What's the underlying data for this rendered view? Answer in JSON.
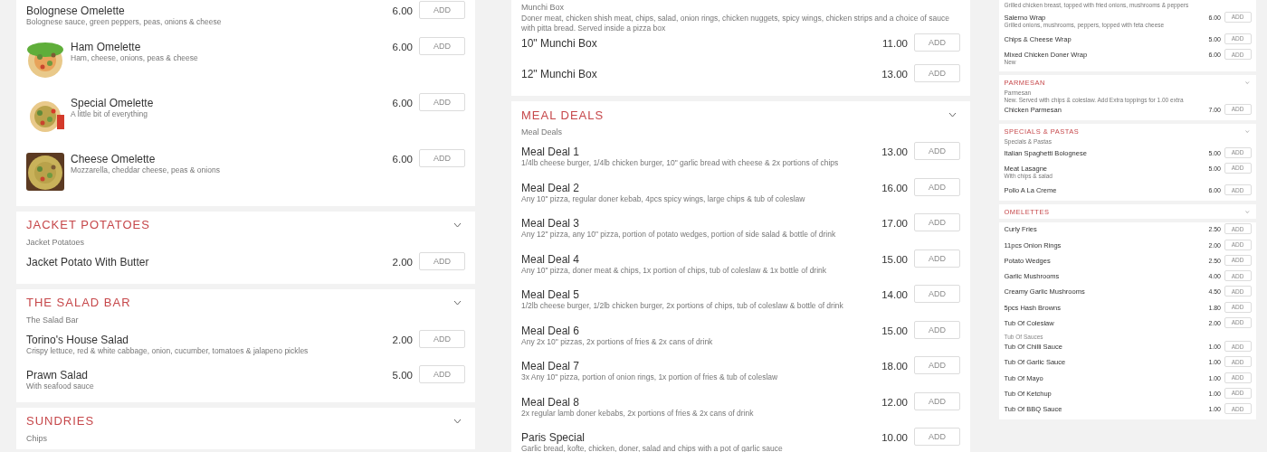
{
  "columns": [
    {
      "sections": [
        {
          "items": [
            {
              "kind": "item",
              "name": "Bolognese Omelette",
              "description": "Bolognese sauce, green peppers, peas, onions & cheese",
              "price": "6.00",
              "button": "ADD"
            },
            {
              "kind": "item",
              "name": "Ham Omelette",
              "description": "Ham, cheese, onions, peas & cheese",
              "price": "6.00",
              "button": "ADD"
            },
            {
              "kind": "item",
              "name": "Special Omelette",
              "description": "A little bit of everything",
              "price": "6.00",
              "button": "ADD"
            },
            {
              "kind": "item",
              "name": "Cheese Omelette",
              "description": "Mozzarella, cheddar cheese, peas & onions",
              "price": "6.00",
              "button": "ADD"
            }
          ]
        },
        {
          "title": "JACKET POTATOES",
          "subtitle": "Jacket Potatoes",
          "items": [
            {
              "kind": "item",
              "name": "Jacket Potato With Butter",
              "price": "2.00",
              "button": "ADD"
            }
          ]
        },
        {
          "title": "THE SALAD BAR",
          "subtitle": "The Salad Bar",
          "items": [
            {
              "kind": "item",
              "name": "Torino's House Salad",
              "description": "Crispy lettuce, red & white cabbage, onion, cucumber, tomatoes & jalapeno pickles",
              "price": "2.00",
              "button": "ADD"
            },
            {
              "kind": "item",
              "name": "Prawn Salad",
              "description": "With seafood sauce",
              "price": "5.00",
              "button": "ADD"
            }
          ]
        },
        {
          "title": "SUNDRIES",
          "subtitle": "Chips"
        }
      ]
    },
    {
      "sections": [
        {
          "subtitle": "Munchi Box",
          "description": "Doner meat, chicken shish meat, chips, salad, onion rings, chicken nuggets, spicy wings, chicken strips and a choice of sauce with pitta bread. Served inside a pizza box",
          "items": [
            {
              "kind": "item",
              "name": "10\" Munchi Box",
              "price": "11.00",
              "button": "ADD"
            },
            {
              "kind": "item",
              "name": "12\" Munchi Box",
              "price": "13.00",
              "button": "ADD"
            }
          ]
        },
        {
          "title": "MEAL DEALS",
          "subtitle": "Meal Deals",
          "items": [
            {
              "kind": "item",
              "name": "Meal Deal 1",
              "description": "1/4lb cheese burger, 1/4lb chicken burger, 10\" garlic bread with cheese & 2x portions of chips",
              "price": "13.00",
              "button": "ADD"
            },
            {
              "kind": "item",
              "name": "Meal Deal 2",
              "description": "Any 10\" pizza, regular doner kebab, 4pcs spicy wings, large chips & tub of coleslaw",
              "price": "16.00",
              "button": "ADD"
            },
            {
              "kind": "item",
              "name": "Meal Deal 3",
              "description": "Any 12\" pizza, any 10\" pizza, portion of potato wedges, portion of side salad & bottle of drink",
              "price": "17.00",
              "button": "ADD"
            },
            {
              "kind": "item",
              "name": "Meal Deal 4",
              "description": "Any 10\" pizza, doner meat & chips, 1x portion of chips, tub of coleslaw & 1x bottle of drink",
              "price": "15.00",
              "button": "ADD"
            },
            {
              "kind": "item",
              "name": "Meal Deal 5",
              "description": "1/2lb cheese burger, 1/2lb chicken burger, 2x portions of chips, tub of coleslaw & bottle of drink",
              "price": "14.00",
              "button": "ADD"
            },
            {
              "kind": "item",
              "name": "Meal Deal 6",
              "description": "Any 2x 10\" pizzas, 2x portions of fries & 2x cans of drink",
              "price": "15.00",
              "button": "ADD"
            },
            {
              "kind": "item",
              "name": "Meal Deal 7",
              "description": "3x Any 10\" pizza, portion of onion rings, 1x portion of fries & tub of coleslaw",
              "price": "18.00",
              "button": "ADD"
            },
            {
              "kind": "item",
              "name": "Meal Deal 8",
              "description": "2x regular lamb doner kebabs, 2x portions of fries & 2x cans of drink",
              "price": "12.00",
              "button": "ADD"
            },
            {
              "kind": "item",
              "name": "Paris Special",
              "description": "Garlic bread, kofte, chicken, doner, salad and chips with a pot of garlic sauce",
              "price": "10.00",
              "button": "ADD"
            }
          ]
        }
      ]
    },
    {
      "sections": [
        {
          "items": [
            {
              "kind": "note",
              "description": "Grilled chicken breast, topped with fried onions, mushrooms & peppers"
            },
            {
              "kind": "item",
              "name": "Salerno Wrap",
              "description": "Grilled onions, mushrooms, peppers, topped with feta cheese",
              "price": "6.00",
              "button": "ADD"
            },
            {
              "kind": "item",
              "name": "Chips & Cheese Wrap",
              "price": "5.00",
              "button": "ADD"
            },
            {
              "kind": "item",
              "name": "Mixed Chicken Doner Wrap",
              "description": "New",
              "price": "6.00",
              "button": "ADD"
            }
          ]
        },
        {
          "title": "PARMESAN",
          "subtitle": "Parmesan",
          "description": "New. Served with chips & coleslaw. Add Extra toppings for 1.00 extra",
          "items": [
            {
              "kind": "item",
              "name": "Chicken Parmesan",
              "price": "7.00",
              "button": "ADD"
            }
          ]
        },
        {
          "title": "SPECIALS & PASTAS",
          "subtitle": "Specials & Pastas",
          "items": [
            {
              "kind": "item",
              "name": "Italian Spaghetti Bolognese",
              "price": "5.00",
              "button": "ADD"
            },
            {
              "kind": "item",
              "name": "Meat Lasagne",
              "description": "With chips & salad",
              "price": "5.00",
              "button": "ADD"
            },
            {
              "kind": "item",
              "name": "Pollo A La Creme",
              "price": "6.00",
              "button": "ADD"
            }
          ]
        },
        {
          "title": "OMELETTES"
        },
        {
          "items": [
            {
              "kind": "item",
              "name": "Curly Fries",
              "price": "2.50",
              "button": "ADD"
            },
            {
              "kind": "item",
              "name": "11pcs Onion Rings",
              "price": "2.00",
              "button": "ADD"
            },
            {
              "kind": "item",
              "name": "Potato Wedges",
              "price": "2.50",
              "button": "ADD"
            },
            {
              "kind": "item",
              "name": "Garlic Mushrooms",
              "price": "4.00",
              "button": "ADD"
            },
            {
              "kind": "item",
              "name": "Creamy Garlic Mushrooms",
              "price": "4.50",
              "button": "ADD"
            },
            {
              "kind": "item",
              "name": "5pcs Hash Browns",
              "price": "1.80",
              "button": "ADD"
            },
            {
              "kind": "item",
              "name": "Tub Of Coleslaw",
              "price": "2.00",
              "button": "ADD"
            },
            {
              "kind": "subheading",
              "name": "Tub Of Sauces"
            },
            {
              "kind": "item",
              "name": "Tub Of Chilli Sauce",
              "price": "1.00",
              "button": "ADD"
            },
            {
              "kind": "item",
              "name": "Tub Of Garlic Sauce",
              "price": "1.00",
              "button": "ADD"
            },
            {
              "kind": "item",
              "name": "Tub Of Mayo",
              "price": "1.00",
              "button": "ADD"
            },
            {
              "kind": "item",
              "name": "Tub Of Ketchup",
              "price": "1.00",
              "button": "ADD"
            },
            {
              "kind": "item",
              "name": "Tub Of BBQ Sauce",
              "price": "1.00",
              "button": "ADD"
            }
          ]
        }
      ]
    }
  ]
}
